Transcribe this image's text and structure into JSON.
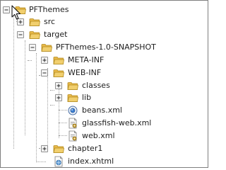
{
  "tree": {
    "root": {
      "label": "PFThemes",
      "expanded": true,
      "icon": "project-folder-icon"
    },
    "src": {
      "label": "src",
      "expanded": false,
      "icon": "folder-icon"
    },
    "target": {
      "label": "target",
      "expanded": true,
      "icon": "folder-icon"
    },
    "snapshot": {
      "label": "PFThemes-1.0-SNAPSHOT",
      "expanded": true,
      "icon": "folder-icon"
    },
    "meta_inf": {
      "label": "META-INF",
      "expanded": false,
      "icon": "folder-icon"
    },
    "web_inf": {
      "label": "WEB-INF",
      "expanded": true,
      "icon": "folder-icon"
    },
    "classes": {
      "label": "classes",
      "expanded": false,
      "icon": "folder-icon"
    },
    "lib": {
      "label": "lib",
      "expanded": false,
      "icon": "folder-icon"
    },
    "beans_xml": {
      "label": "beans.xml",
      "icon": "beans-xml-icon"
    },
    "glassfish_web_xml": {
      "label": "glassfish-web.xml",
      "icon": "xml-config-file-icon"
    },
    "web_xml": {
      "label": "web.xml",
      "icon": "xml-config-file-icon"
    },
    "chapter1": {
      "label": "chapter1",
      "expanded": false,
      "icon": "folder-icon"
    },
    "index_xhtml": {
      "label": "index.xhtml",
      "icon": "xhtml-file-icon"
    }
  },
  "colors": {
    "folder_fill": "#f1cf6e",
    "folder_tab": "#e9b949",
    "folder_stroke": "#b38b1f",
    "connector": "#a0a0a0",
    "frame_border": "#7f7f7f"
  }
}
